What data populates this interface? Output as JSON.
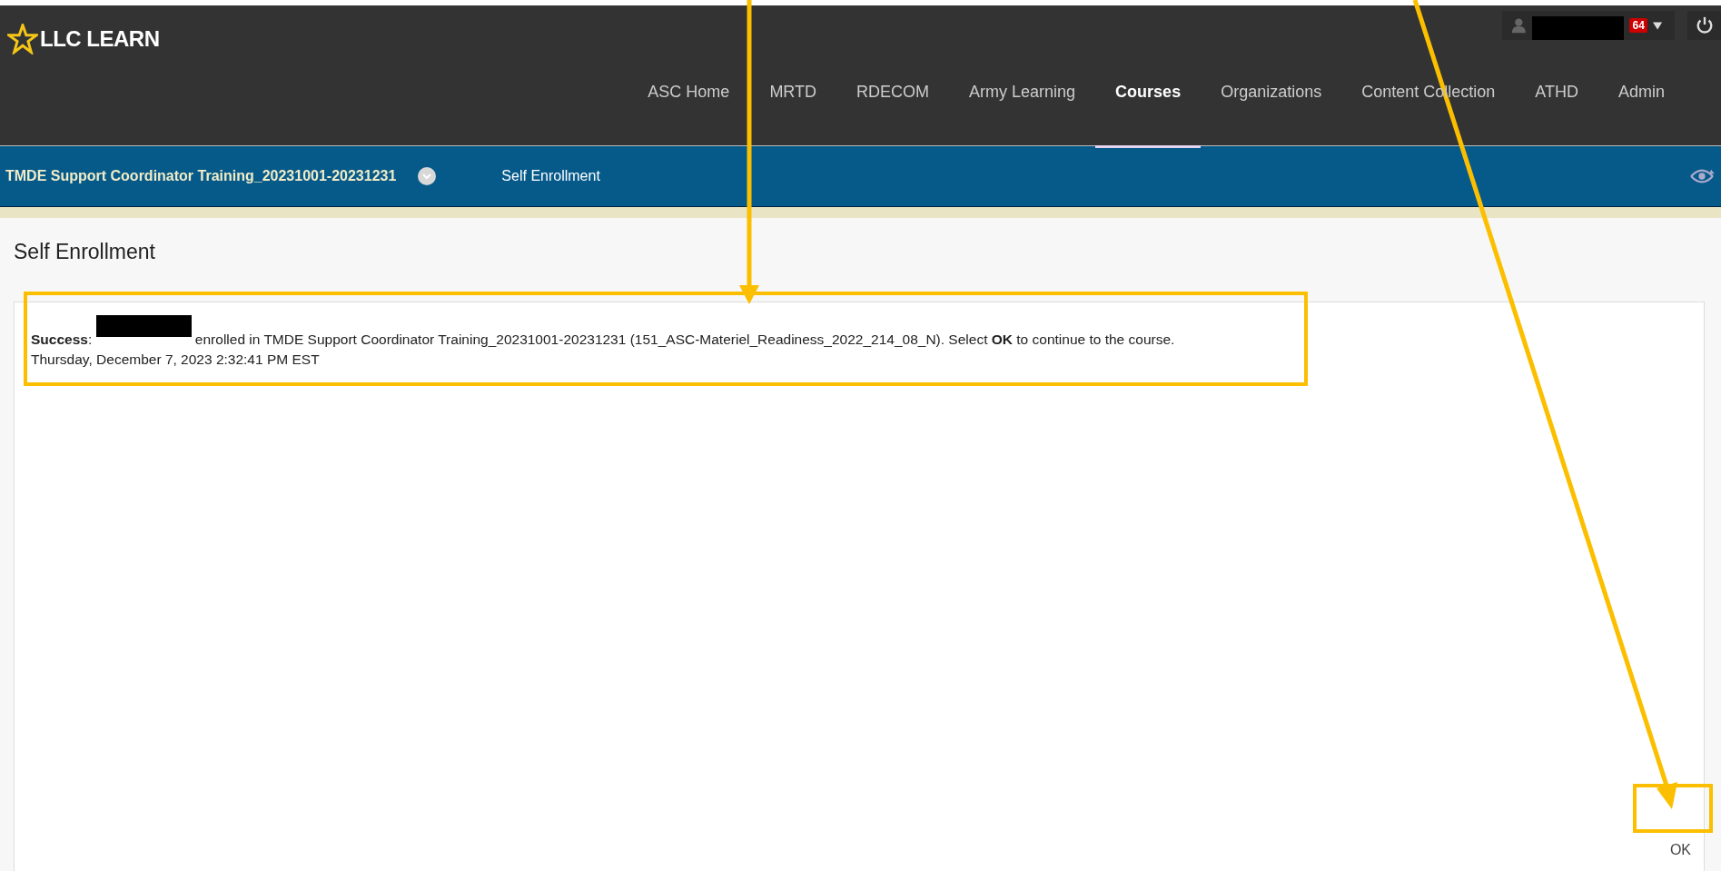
{
  "header": {
    "logo": "LLC LEARN",
    "user_menu": {
      "badge": "64"
    },
    "nav": [
      {
        "label": "ASC Home",
        "selected": false
      },
      {
        "label": "MRTD",
        "selected": false
      },
      {
        "label": "RDECOM",
        "selected": false
      },
      {
        "label": "Army Learning",
        "selected": false
      },
      {
        "label": "Courses",
        "selected": true
      },
      {
        "label": "Organizations",
        "selected": false
      },
      {
        "label": "Content Collection",
        "selected": false
      },
      {
        "label": "ATHD",
        "selected": false
      },
      {
        "label": "Admin",
        "selected": false
      }
    ]
  },
  "breadcrumb": {
    "course": "TMDE Support Coordinator Training_20231001-20231231",
    "page": "Self Enrollment"
  },
  "page_title": "Self Enrollment",
  "message": {
    "prefix": "**Success**:",
    "text": "enrolled in TMDE Support Coordinator Training_20231001-20231231 (151_ASC-Materiel_Readiness_2022_214_08_N). Select **OK** to continue to the course.",
    "timestamp": "Thursday, December 7, 2023 2:32:41 PM EST"
  },
  "ok_button": "OK"
}
